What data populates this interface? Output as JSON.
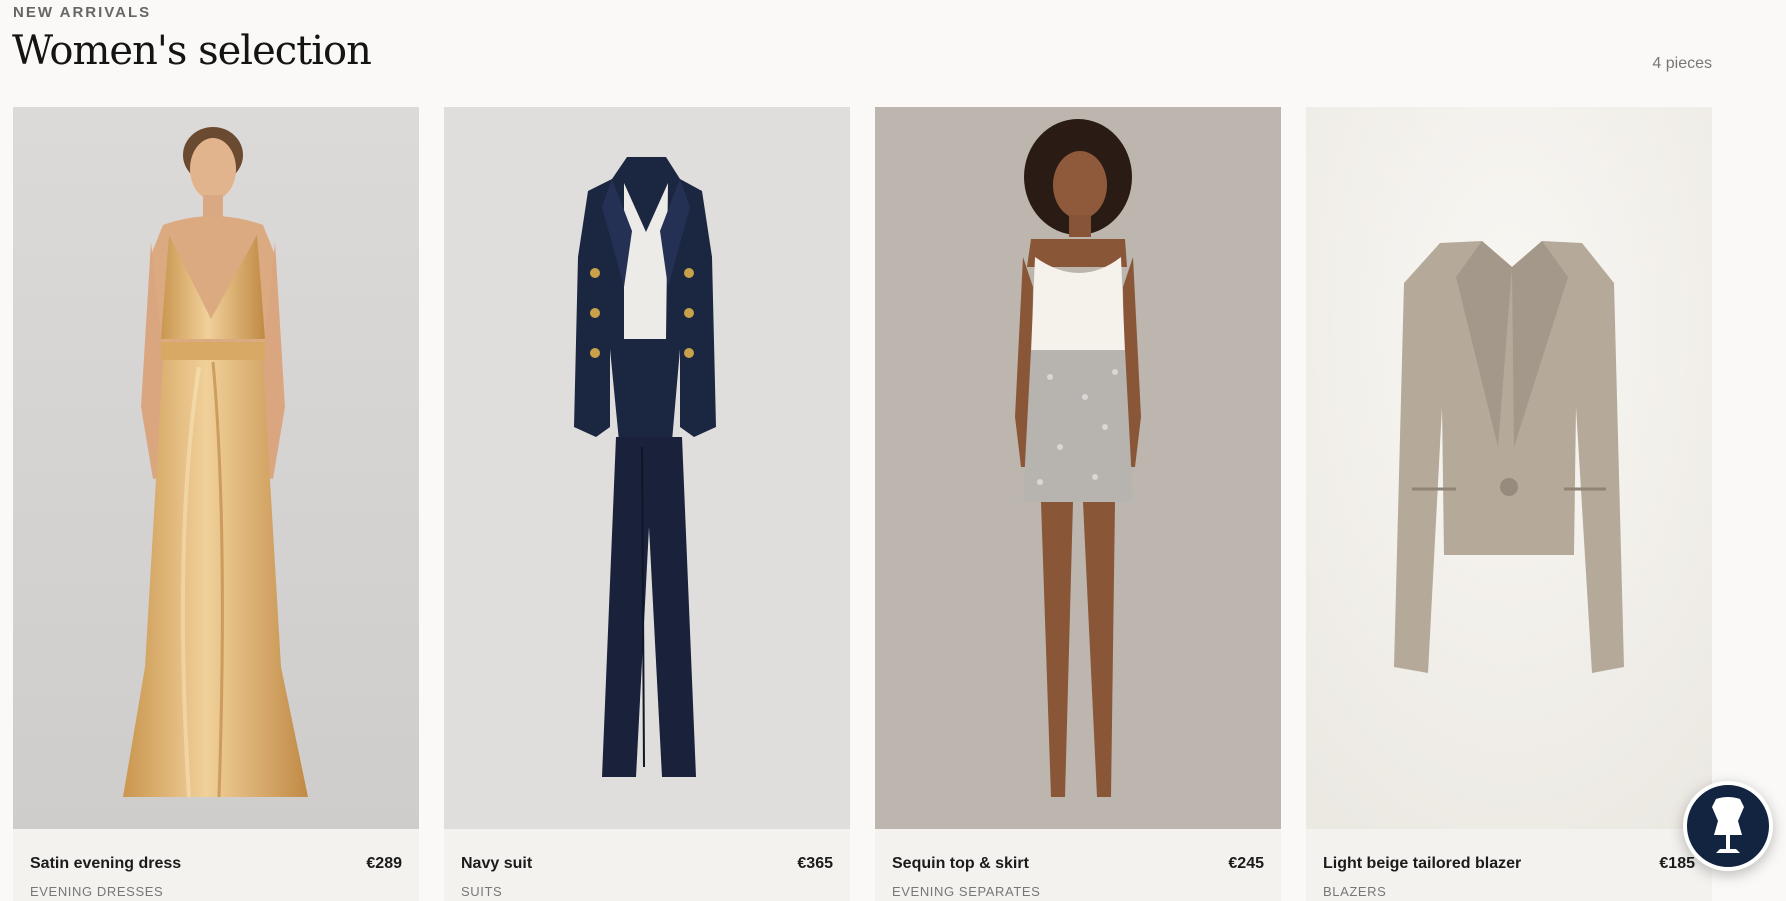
{
  "header": {
    "eyebrow": "NEW ARRIVALS",
    "title": "Women's selection",
    "count": "4 pieces"
  },
  "products": [
    {
      "name": "Satin evening dress",
      "price": "€289",
      "category": "EVENING DRESSES",
      "image": "gold-satin-gown-photo"
    },
    {
      "name": "Navy suit",
      "price": "€365",
      "category": "SUITS",
      "image": "navy-suit-photo"
    },
    {
      "name": "Sequin top & skirt",
      "price": "€245",
      "category": "EVENING SEPARATES",
      "image": "sequin-skirt-outfit-photo"
    },
    {
      "name": "Light beige tailored blazer",
      "price": "€185",
      "category": "BLAZERS",
      "image": "beige-blazer-photo"
    }
  ],
  "fab": {
    "icon": "dress-form-icon"
  },
  "colors": {
    "background": "#faf9f7",
    "fab": "#12243f",
    "accent_gold": "#d8a964",
    "navy": "#1b2640",
    "beige": "#b5a999"
  }
}
